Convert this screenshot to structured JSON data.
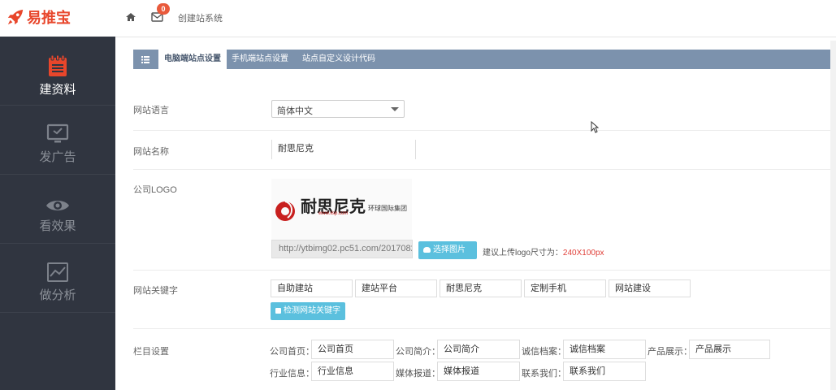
{
  "header": {
    "logo_text": "易推宝",
    "mail_badge": "0",
    "breadcrumb": "创建站系统"
  },
  "sidebar": {
    "items": [
      {
        "label": "建资料",
        "icon": "notepad-icon",
        "active": true
      },
      {
        "label": "发广告",
        "icon": "monitor-icon",
        "active": false
      },
      {
        "label": "看效果",
        "icon": "eye-icon",
        "active": false
      },
      {
        "label": "做分析",
        "icon": "chart-icon",
        "active": false
      }
    ]
  },
  "tabs": [
    {
      "label": "电脑端站点设置",
      "active": true
    },
    {
      "label": "手机端站点设置",
      "active": false
    },
    {
      "label": "站点自定义设计代码",
      "active": false
    }
  ],
  "form": {
    "language": {
      "label": "网站语言",
      "value": "简体中文"
    },
    "name": {
      "label": "网站名称",
      "value": "耐思尼克"
    },
    "logo": {
      "label": "公司LOGO",
      "brand_text": "耐思尼克",
      "brand_sub": "环球国际集团",
      "brand_url": "www.iisp.com",
      "path": "http://ytbimg02.pc51.com/2017082",
      "button": "选择图片",
      "hint": "建议上传logo尺寸为：",
      "hint_size": "240X100px"
    },
    "keywords": {
      "label": "网站关键字",
      "items": [
        "自助建站",
        "建站平台",
        "耐思尼克",
        "定制手机",
        "网站建设"
      ],
      "check_button": "检测网站关键字"
    },
    "columns": {
      "label": "栏目设置",
      "items": [
        {
          "label": "公司首页：",
          "value": "公司首页"
        },
        {
          "label": "公司简介：",
          "value": "公司简介"
        },
        {
          "label": "诚信档案：",
          "value": "诚信档案"
        },
        {
          "label": "产品展示：",
          "value": "产品展示"
        },
        {
          "label": "行业信息：",
          "value": "行业信息"
        },
        {
          "label": "媒体报道：",
          "value": "媒体报道"
        },
        {
          "label": "联系我们：",
          "value": "联系我们"
        }
      ]
    }
  },
  "colors": {
    "brand": "#e8462b",
    "sidebar_bg": "#303540",
    "tabbar_bg": "#7c92ad",
    "button": "#5bc0de",
    "badge": "#e95a3c"
  }
}
